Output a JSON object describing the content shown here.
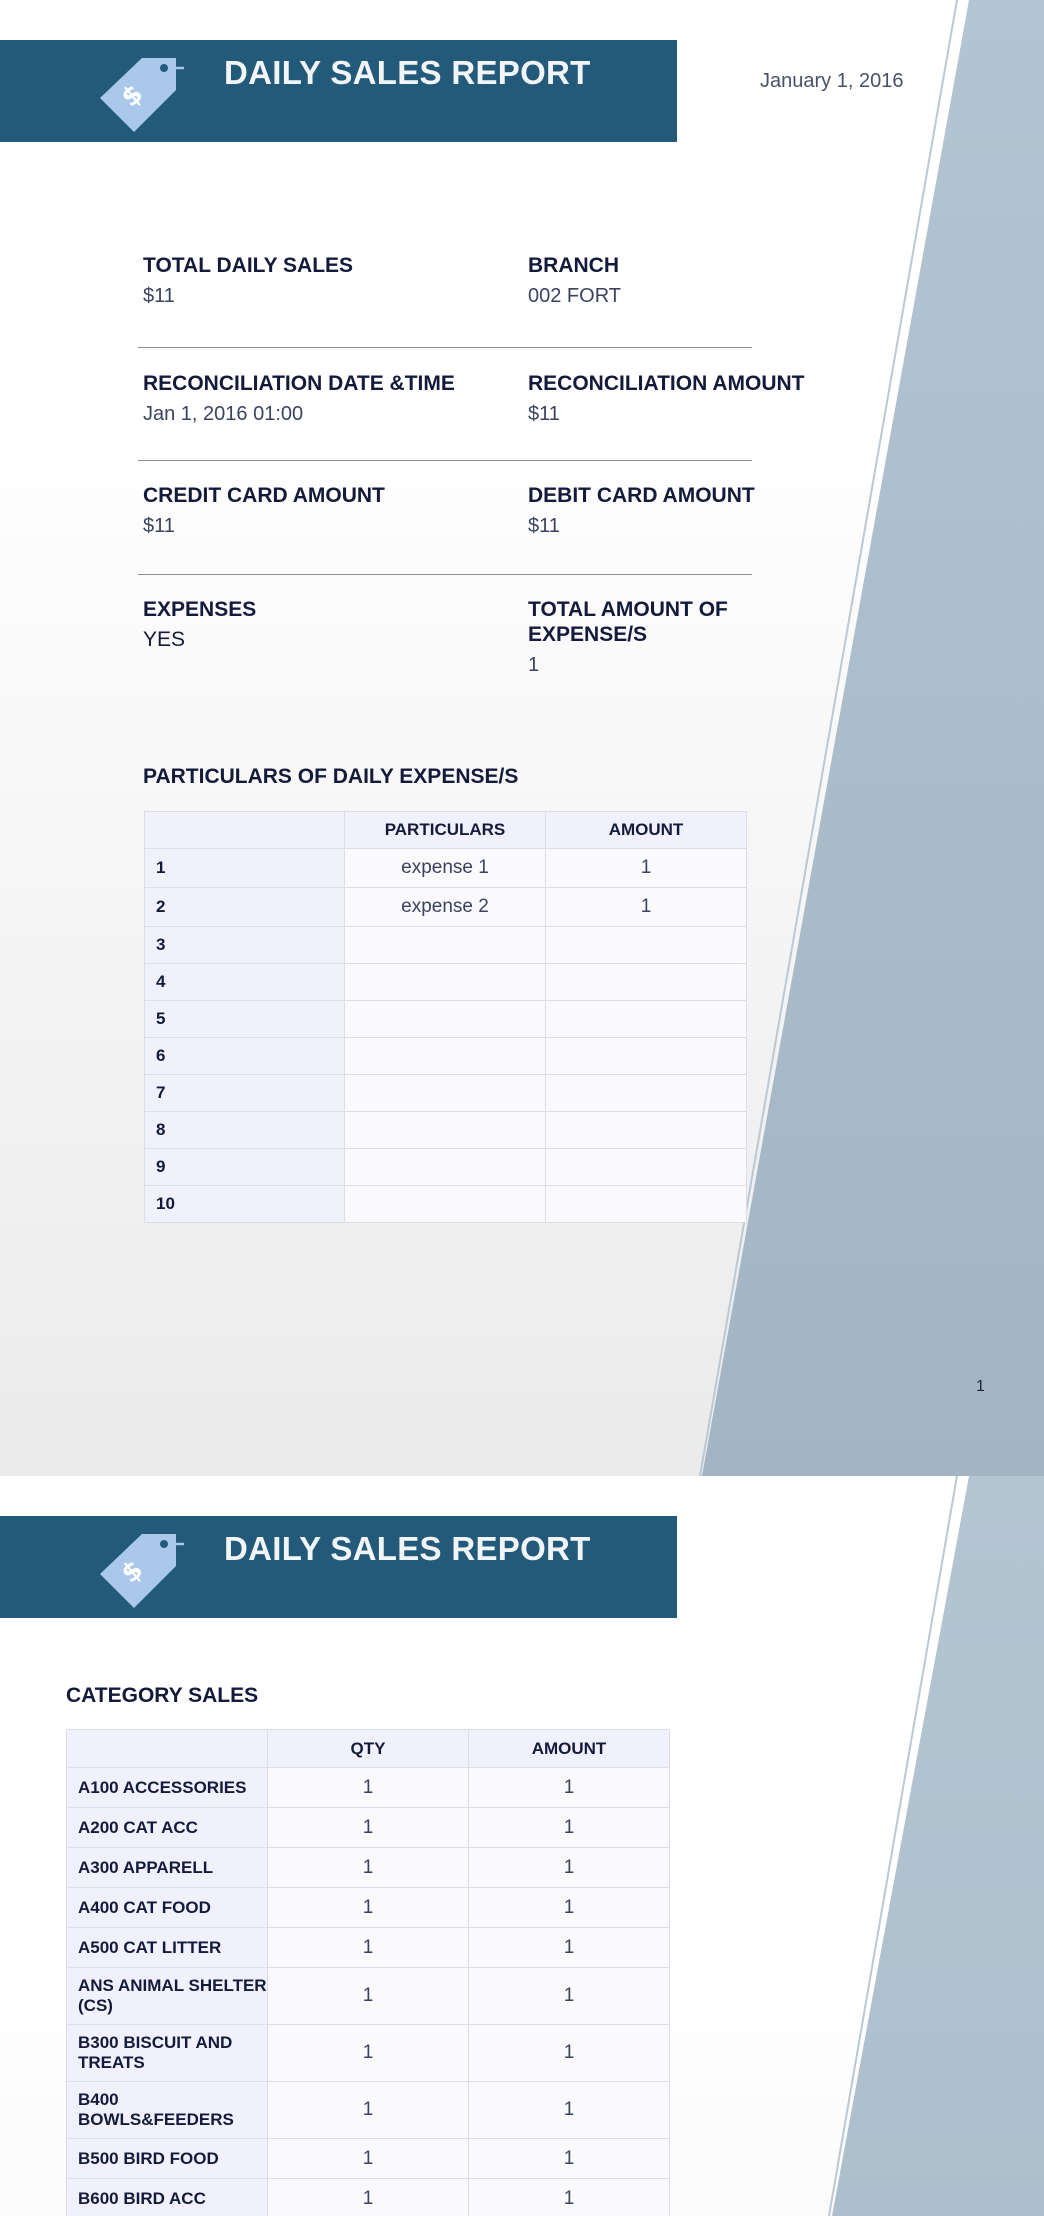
{
  "report": {
    "title": "DAILY SALES REPORT",
    "date": "January 1, 2016",
    "page_number": "1"
  },
  "summary": {
    "total_daily_sales": {
      "label": "TOTAL DAILY SALES",
      "value": "$11"
    },
    "branch": {
      "label": "BRANCH",
      "value": "002 FORT"
    },
    "reconciliation_datetime": {
      "label": "RECONCILIATION DATE &TIME",
      "value": "Jan 1, 2016 01:00"
    },
    "reconciliation_amount": {
      "label": "RECONCILIATION AMOUNT",
      "value": "$11"
    },
    "credit_card_amount": {
      "label": "CREDIT CARD AMOUNT",
      "value": "$11"
    },
    "debit_card_amount": {
      "label": "DEBIT CARD AMOUNT",
      "value": "$11"
    },
    "expenses": {
      "label": "EXPENSES",
      "value": "YES"
    },
    "total_expenses": {
      "label_line1": "TOTAL AMOUNT OF",
      "label_line2": "EXPENSE/S",
      "value": "1"
    }
  },
  "expenses_table": {
    "title": "PARTICULARS OF DAILY EXPENSE/S",
    "headers": [
      "",
      "PARTICULARS",
      "AMOUNT"
    ],
    "rows": [
      [
        "1",
        "expense 1",
        "1"
      ],
      [
        "2",
        "expense 2",
        "1"
      ],
      [
        "3",
        "",
        ""
      ],
      [
        "4",
        "",
        ""
      ],
      [
        "5",
        "",
        ""
      ],
      [
        "6",
        "",
        ""
      ],
      [
        "7",
        "",
        ""
      ],
      [
        "8",
        "",
        ""
      ],
      [
        "9",
        "",
        ""
      ],
      [
        "10",
        "",
        ""
      ]
    ]
  },
  "category_table": {
    "title": "CATEGORY SALES",
    "headers": [
      "",
      "QTY",
      "AMOUNT"
    ],
    "rows": [
      [
        "A100 ACCESSORIES",
        "1",
        "1"
      ],
      [
        "A200 CAT ACC",
        "1",
        "1"
      ],
      [
        "A300 APPARELL",
        "1",
        "1"
      ],
      [
        "A400 CAT FOOD",
        "1",
        "1"
      ],
      [
        "A500 CAT LITTER",
        "1",
        "1"
      ],
      [
        "ANS ANIMAL SHELTER (CS)",
        "1",
        "1"
      ],
      [
        "B300 BISCUIT AND TREATS",
        "1",
        "1"
      ],
      [
        "B400 BOWLS&FEEDERS",
        "1",
        "1"
      ],
      [
        "B500 BIRD FOOD",
        "1",
        "1"
      ],
      [
        "B600 BIRD ACC",
        "1",
        "1"
      ]
    ]
  },
  "icons": {
    "tag": "price-tag-dollar-icon"
  },
  "colors": {
    "banner": "#235a7a",
    "tag": "#a9c8ea",
    "side_panel": "#a7b9c8",
    "table_header": "#f1f1fd"
  }
}
